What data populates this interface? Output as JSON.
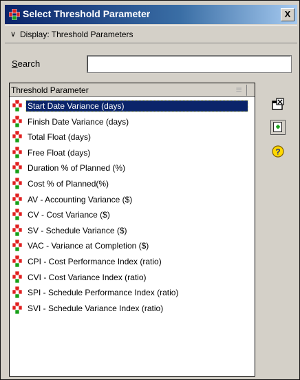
{
  "window": {
    "title": "Select Threshold Parameter",
    "close_label": "X"
  },
  "display": {
    "label": "Display: Threshold Parameters"
  },
  "search": {
    "label_underlined": "S",
    "label_rest": "earch",
    "value": "",
    "placeholder": ""
  },
  "list": {
    "column_header": "Threshold Parameter",
    "items": [
      {
        "label": "Start Date Variance (days)",
        "selected": true
      },
      {
        "label": "Finish Date Variance (days)"
      },
      {
        "label": "Total Float (days)"
      },
      {
        "label": "Free Float (days)"
      },
      {
        "label": "Duration % of Planned (%)"
      },
      {
        "label": "Cost % of Planned(%)"
      },
      {
        "label": "AV - Accounting Variance ($)"
      },
      {
        "label": "CV - Cost Variance ($)"
      },
      {
        "label": "SV - Schedule Variance ($)"
      },
      {
        "label": "VAC - Variance at Completion ($)"
      },
      {
        "label": "CPI - Cost Performance Index (ratio)"
      },
      {
        "label": "CVI - Cost Variance Index (ratio)"
      },
      {
        "label": "SPI - Schedule Performance Index (ratio)"
      },
      {
        "label": "SVI - Schedule Variance Index (ratio)"
      }
    ]
  },
  "side_buttons": [
    {
      "icon": "select-icon"
    },
    {
      "icon": "add-icon"
    },
    {
      "icon": "help-icon"
    }
  ],
  "colors": {
    "titlebar_start": "#0a246a",
    "titlebar_end": "#a6caf0",
    "selection": "#0a246a",
    "icon_red": "#e02020",
    "icon_green": "#18a018"
  }
}
